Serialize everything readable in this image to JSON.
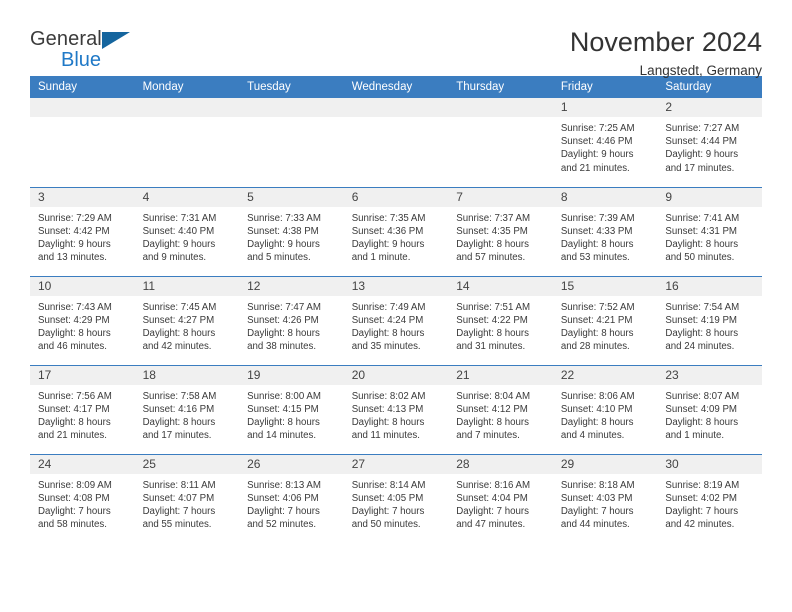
{
  "brand": {
    "name_part1": "General",
    "name_part2": "Blue",
    "accent_color": "#2079c7",
    "triangle_color": "#15659e"
  },
  "header": {
    "title": "November 2024",
    "location": "Langstedt, Germany"
  },
  "theme": {
    "header_row_bg": "#3b7dc0",
    "daynum_bg": "#f0f0f0",
    "text_color": "#333333"
  },
  "weekday_headers": [
    "Sunday",
    "Monday",
    "Tuesday",
    "Wednesday",
    "Thursday",
    "Friday",
    "Saturday"
  ],
  "labels": {
    "sunrise_prefix": "Sunrise:",
    "sunset_prefix": "Sunset:",
    "daylight_prefix": "Daylight:"
  },
  "weeks": [
    [
      {
        "day": "",
        "blank": true,
        "sunrise": "",
        "sunset": "",
        "daylight_line1": "",
        "daylight_line2": ""
      },
      {
        "day": "",
        "blank": true,
        "sunrise": "",
        "sunset": "",
        "daylight_line1": "",
        "daylight_line2": ""
      },
      {
        "day": "",
        "blank": true,
        "sunrise": "",
        "sunset": "",
        "daylight_line1": "",
        "daylight_line2": ""
      },
      {
        "day": "",
        "blank": true,
        "sunrise": "",
        "sunset": "",
        "daylight_line1": "",
        "daylight_line2": ""
      },
      {
        "day": "",
        "blank": true,
        "sunrise": "",
        "sunset": "",
        "daylight_line1": "",
        "daylight_line2": ""
      },
      {
        "day": "1",
        "blank": false,
        "sunrise": "Sunrise: 7:25 AM",
        "sunset": "Sunset: 4:46 PM",
        "daylight_line1": "Daylight: 9 hours",
        "daylight_line2": "and 21 minutes."
      },
      {
        "day": "2",
        "blank": false,
        "sunrise": "Sunrise: 7:27 AM",
        "sunset": "Sunset: 4:44 PM",
        "daylight_line1": "Daylight: 9 hours",
        "daylight_line2": "and 17 minutes."
      }
    ],
    [
      {
        "day": "3",
        "blank": false,
        "sunrise": "Sunrise: 7:29 AM",
        "sunset": "Sunset: 4:42 PM",
        "daylight_line1": "Daylight: 9 hours",
        "daylight_line2": "and 13 minutes."
      },
      {
        "day": "4",
        "blank": false,
        "sunrise": "Sunrise: 7:31 AM",
        "sunset": "Sunset: 4:40 PM",
        "daylight_line1": "Daylight: 9 hours",
        "daylight_line2": "and 9 minutes."
      },
      {
        "day": "5",
        "blank": false,
        "sunrise": "Sunrise: 7:33 AM",
        "sunset": "Sunset: 4:38 PM",
        "daylight_line1": "Daylight: 9 hours",
        "daylight_line2": "and 5 minutes."
      },
      {
        "day": "6",
        "blank": false,
        "sunrise": "Sunrise: 7:35 AM",
        "sunset": "Sunset: 4:36 PM",
        "daylight_line1": "Daylight: 9 hours",
        "daylight_line2": "and 1 minute."
      },
      {
        "day": "7",
        "blank": false,
        "sunrise": "Sunrise: 7:37 AM",
        "sunset": "Sunset: 4:35 PM",
        "daylight_line1": "Daylight: 8 hours",
        "daylight_line2": "and 57 minutes."
      },
      {
        "day": "8",
        "blank": false,
        "sunrise": "Sunrise: 7:39 AM",
        "sunset": "Sunset: 4:33 PM",
        "daylight_line1": "Daylight: 8 hours",
        "daylight_line2": "and 53 minutes."
      },
      {
        "day": "9",
        "blank": false,
        "sunrise": "Sunrise: 7:41 AM",
        "sunset": "Sunset: 4:31 PM",
        "daylight_line1": "Daylight: 8 hours",
        "daylight_line2": "and 50 minutes."
      }
    ],
    [
      {
        "day": "10",
        "blank": false,
        "sunrise": "Sunrise: 7:43 AM",
        "sunset": "Sunset: 4:29 PM",
        "daylight_line1": "Daylight: 8 hours",
        "daylight_line2": "and 46 minutes."
      },
      {
        "day": "11",
        "blank": false,
        "sunrise": "Sunrise: 7:45 AM",
        "sunset": "Sunset: 4:27 PM",
        "daylight_line1": "Daylight: 8 hours",
        "daylight_line2": "and 42 minutes."
      },
      {
        "day": "12",
        "blank": false,
        "sunrise": "Sunrise: 7:47 AM",
        "sunset": "Sunset: 4:26 PM",
        "daylight_line1": "Daylight: 8 hours",
        "daylight_line2": "and 38 minutes."
      },
      {
        "day": "13",
        "blank": false,
        "sunrise": "Sunrise: 7:49 AM",
        "sunset": "Sunset: 4:24 PM",
        "daylight_line1": "Daylight: 8 hours",
        "daylight_line2": "and 35 minutes."
      },
      {
        "day": "14",
        "blank": false,
        "sunrise": "Sunrise: 7:51 AM",
        "sunset": "Sunset: 4:22 PM",
        "daylight_line1": "Daylight: 8 hours",
        "daylight_line2": "and 31 minutes."
      },
      {
        "day": "15",
        "blank": false,
        "sunrise": "Sunrise: 7:52 AM",
        "sunset": "Sunset: 4:21 PM",
        "daylight_line1": "Daylight: 8 hours",
        "daylight_line2": "and 28 minutes."
      },
      {
        "day": "16",
        "blank": false,
        "sunrise": "Sunrise: 7:54 AM",
        "sunset": "Sunset: 4:19 PM",
        "daylight_line1": "Daylight: 8 hours",
        "daylight_line2": "and 24 minutes."
      }
    ],
    [
      {
        "day": "17",
        "blank": false,
        "sunrise": "Sunrise: 7:56 AM",
        "sunset": "Sunset: 4:17 PM",
        "daylight_line1": "Daylight: 8 hours",
        "daylight_line2": "and 21 minutes."
      },
      {
        "day": "18",
        "blank": false,
        "sunrise": "Sunrise: 7:58 AM",
        "sunset": "Sunset: 4:16 PM",
        "daylight_line1": "Daylight: 8 hours",
        "daylight_line2": "and 17 minutes."
      },
      {
        "day": "19",
        "blank": false,
        "sunrise": "Sunrise: 8:00 AM",
        "sunset": "Sunset: 4:15 PM",
        "daylight_line1": "Daylight: 8 hours",
        "daylight_line2": "and 14 minutes."
      },
      {
        "day": "20",
        "blank": false,
        "sunrise": "Sunrise: 8:02 AM",
        "sunset": "Sunset: 4:13 PM",
        "daylight_line1": "Daylight: 8 hours",
        "daylight_line2": "and 11 minutes."
      },
      {
        "day": "21",
        "blank": false,
        "sunrise": "Sunrise: 8:04 AM",
        "sunset": "Sunset: 4:12 PM",
        "daylight_line1": "Daylight: 8 hours",
        "daylight_line2": "and 7 minutes."
      },
      {
        "day": "22",
        "blank": false,
        "sunrise": "Sunrise: 8:06 AM",
        "sunset": "Sunset: 4:10 PM",
        "daylight_line1": "Daylight: 8 hours",
        "daylight_line2": "and 4 minutes."
      },
      {
        "day": "23",
        "blank": false,
        "sunrise": "Sunrise: 8:07 AM",
        "sunset": "Sunset: 4:09 PM",
        "daylight_line1": "Daylight: 8 hours",
        "daylight_line2": "and 1 minute."
      }
    ],
    [
      {
        "day": "24",
        "blank": false,
        "sunrise": "Sunrise: 8:09 AM",
        "sunset": "Sunset: 4:08 PM",
        "daylight_line1": "Daylight: 7 hours",
        "daylight_line2": "and 58 minutes."
      },
      {
        "day": "25",
        "blank": false,
        "sunrise": "Sunrise: 8:11 AM",
        "sunset": "Sunset: 4:07 PM",
        "daylight_line1": "Daylight: 7 hours",
        "daylight_line2": "and 55 minutes."
      },
      {
        "day": "26",
        "blank": false,
        "sunrise": "Sunrise: 8:13 AM",
        "sunset": "Sunset: 4:06 PM",
        "daylight_line1": "Daylight: 7 hours",
        "daylight_line2": "and 52 minutes."
      },
      {
        "day": "27",
        "blank": false,
        "sunrise": "Sunrise: 8:14 AM",
        "sunset": "Sunset: 4:05 PM",
        "daylight_line1": "Daylight: 7 hours",
        "daylight_line2": "and 50 minutes."
      },
      {
        "day": "28",
        "blank": false,
        "sunrise": "Sunrise: 8:16 AM",
        "sunset": "Sunset: 4:04 PM",
        "daylight_line1": "Daylight: 7 hours",
        "daylight_line2": "and 47 minutes."
      },
      {
        "day": "29",
        "blank": false,
        "sunrise": "Sunrise: 8:18 AM",
        "sunset": "Sunset: 4:03 PM",
        "daylight_line1": "Daylight: 7 hours",
        "daylight_line2": "and 44 minutes."
      },
      {
        "day": "30",
        "blank": false,
        "sunrise": "Sunrise: 8:19 AM",
        "sunset": "Sunset: 4:02 PM",
        "daylight_line1": "Daylight: 7 hours",
        "daylight_line2": "and 42 minutes."
      }
    ]
  ]
}
